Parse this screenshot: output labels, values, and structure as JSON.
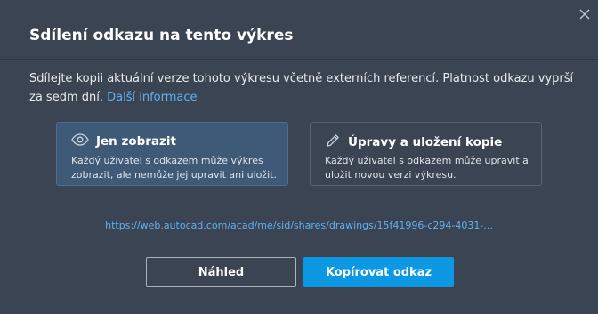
{
  "dialog": {
    "title": "Sdílení odkazu na tento výkres",
    "description": "Sdílejte kopii aktuální verze tohoto výkresu včetně externích referencí. Platnost odkazu vyprší za sedm dní.",
    "learn_more": "Další informace",
    "close_icon": "close-icon"
  },
  "options": [
    {
      "icon": "eye-icon",
      "title": "Jen zobrazit",
      "description": "Každý uživatel s odkazem může výkres zobrazit, ale nemůže jej upravit ani uložit.",
      "selected": true
    },
    {
      "icon": "pencil-icon",
      "title": "Úpravy a uložení kopie",
      "description": "Každý uživatel s odkazem může upravit a uložit novou verzi výkresu.",
      "selected": false
    }
  ],
  "share_link": "https://web.autocad.com/acad/me/sid/shares/drawings/15f41996-c294-4031-...",
  "buttons": {
    "preview": "Náhled",
    "copy": "Kopírovat odkaz"
  },
  "colors": {
    "background": "#3b4453",
    "accent": "#0d98e3",
    "link": "#5fb1f0",
    "selected_option": "#3f5a76"
  }
}
